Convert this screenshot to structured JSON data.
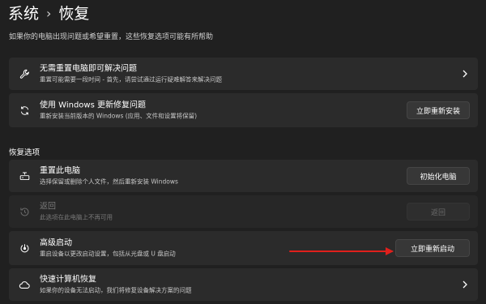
{
  "breadcrumb": {
    "parent": "系统",
    "separator": "›",
    "current": "恢复"
  },
  "subtitle": "如果你的电脑出现问题或希望重置，这些恢复选项可能有所帮助",
  "section_title": "恢复选项",
  "cards": [
    {
      "icon": "wrench-icon",
      "title": "无需重置电脑即可解决问题",
      "desc": "重置可能需要一段时间 - 首先，请尝试通过运行疑难解答来解决问题",
      "action": "chevron"
    },
    {
      "icon": "refresh-icon",
      "title": "使用 Windows 更新修复问题",
      "desc": "重新安装当前版本的 Windows (应用、文件和设置将保留)",
      "action": "button",
      "button": "立即重新安装"
    },
    {
      "icon": "reset-pc-icon",
      "title": "重置此电脑",
      "desc": "选择保留或删除个人文件，然后重新安装 Windows",
      "action": "button",
      "button": "初始化电脑"
    },
    {
      "icon": "history-icon",
      "title": "返回",
      "desc": "此选项在此电脑上不再可用",
      "action": "button",
      "button": "返回",
      "disabled": true
    },
    {
      "icon": "advanced-startup-icon",
      "title": "高级启动",
      "desc": "重启设备以更改启动设置，包括从光盘或 U 盘启动",
      "action": "button",
      "button": "立即重新启动"
    },
    {
      "icon": "cloud-icon",
      "title": "快速计算机恢复",
      "desc": "如果你的设备无法启动，我们将修复设备解决方案的问题",
      "action": "chevron"
    }
  ],
  "colors": {
    "background": "#202020",
    "card": "#2b2b2b",
    "button": "#373737",
    "annotation_arrow": "#e0201c"
  }
}
